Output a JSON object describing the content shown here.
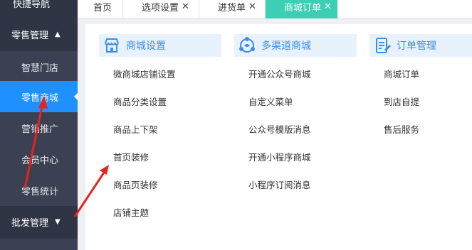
{
  "sidebar": {
    "top_label": "快捷导航",
    "groups": [
      {
        "label": "零售管理",
        "expanded": true,
        "items": [
          "智慧门店",
          "零售商城",
          "营销推广",
          "会员中心",
          "零售统计"
        ],
        "active_item": "零售商城"
      },
      {
        "label": "批发管理",
        "expanded": false
      }
    ],
    "active_color": "#1e90ff"
  },
  "tabs": [
    {
      "label": "首页",
      "closable": false
    },
    {
      "label": "选项设置",
      "closable": true
    },
    {
      "label": "进货单",
      "closable": true
    },
    {
      "label": "商城订单",
      "closable": true,
      "active": true
    }
  ],
  "tab_active_color": "#3ccfb5",
  "menu": {
    "columns": [
      {
        "title": "商城设置",
        "icon": "shop-icon",
        "items": [
          "微商城店铺设置",
          "商品分类设置",
          "商品上下架",
          "首页装修",
          "商品页装修",
          "店铺主题"
        ]
      },
      {
        "title": "多渠道商城",
        "icon": "multichannel-icon",
        "items": [
          "开通公众号商城",
          "自定义菜单",
          "公众号模版消息",
          "开通小程序商城",
          "小程序订阅消息"
        ]
      },
      {
        "title": "订单管理",
        "icon": "order-icon",
        "items": [
          "商城订单",
          "到店自提",
          "售后服务"
        ]
      }
    ],
    "header_color": "#e8f2fd",
    "title_color": "#3d8ee8"
  },
  "annotations": {
    "arrow_color": "#e8231f"
  }
}
